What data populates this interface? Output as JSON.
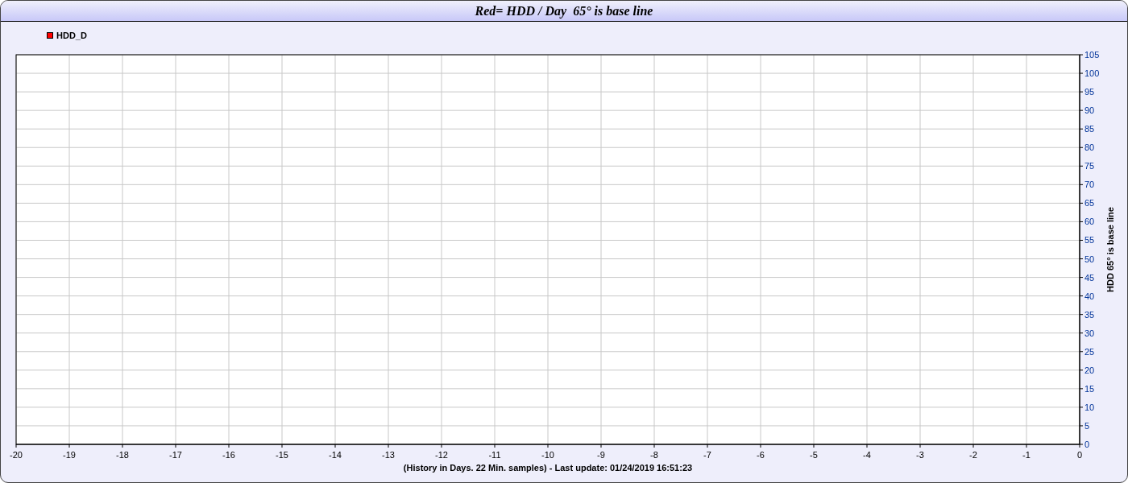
{
  "title": "Red= HDD / Day  65° is base line",
  "chart_data": {
    "type": "line",
    "ylabel": "HDD 65° is base line",
    "xlabel": "(History in Days. 22 Min. samples) - Last update: 01/24/2019 16:51:23",
    "categories": [
      "-20",
      "-19",
      "-18",
      "-17",
      "-16",
      "-15",
      "-14",
      "-13",
      "-12",
      "-11",
      "-10",
      "-9",
      "-8",
      "-7",
      "-6",
      "-5",
      "-4",
      "-3",
      "-2",
      "-1",
      "0"
    ],
    "grid": true,
    "series": [
      {
        "name": "HDD_D",
        "color": "#ff0000",
        "values": [
          null,
          null,
          null,
          null,
          null,
          null,
          null,
          null,
          null,
          null,
          null,
          null,
          null,
          null,
          null,
          null,
          null,
          null,
          null,
          null,
          null
        ]
      }
    ],
    "ylim": [
      0,
      105
    ],
    "yticks": [
      0,
      5,
      10,
      15,
      20,
      25,
      30,
      35,
      40,
      45,
      50,
      55,
      60,
      65,
      70,
      75,
      80,
      85,
      90,
      95,
      100,
      105
    ]
  }
}
